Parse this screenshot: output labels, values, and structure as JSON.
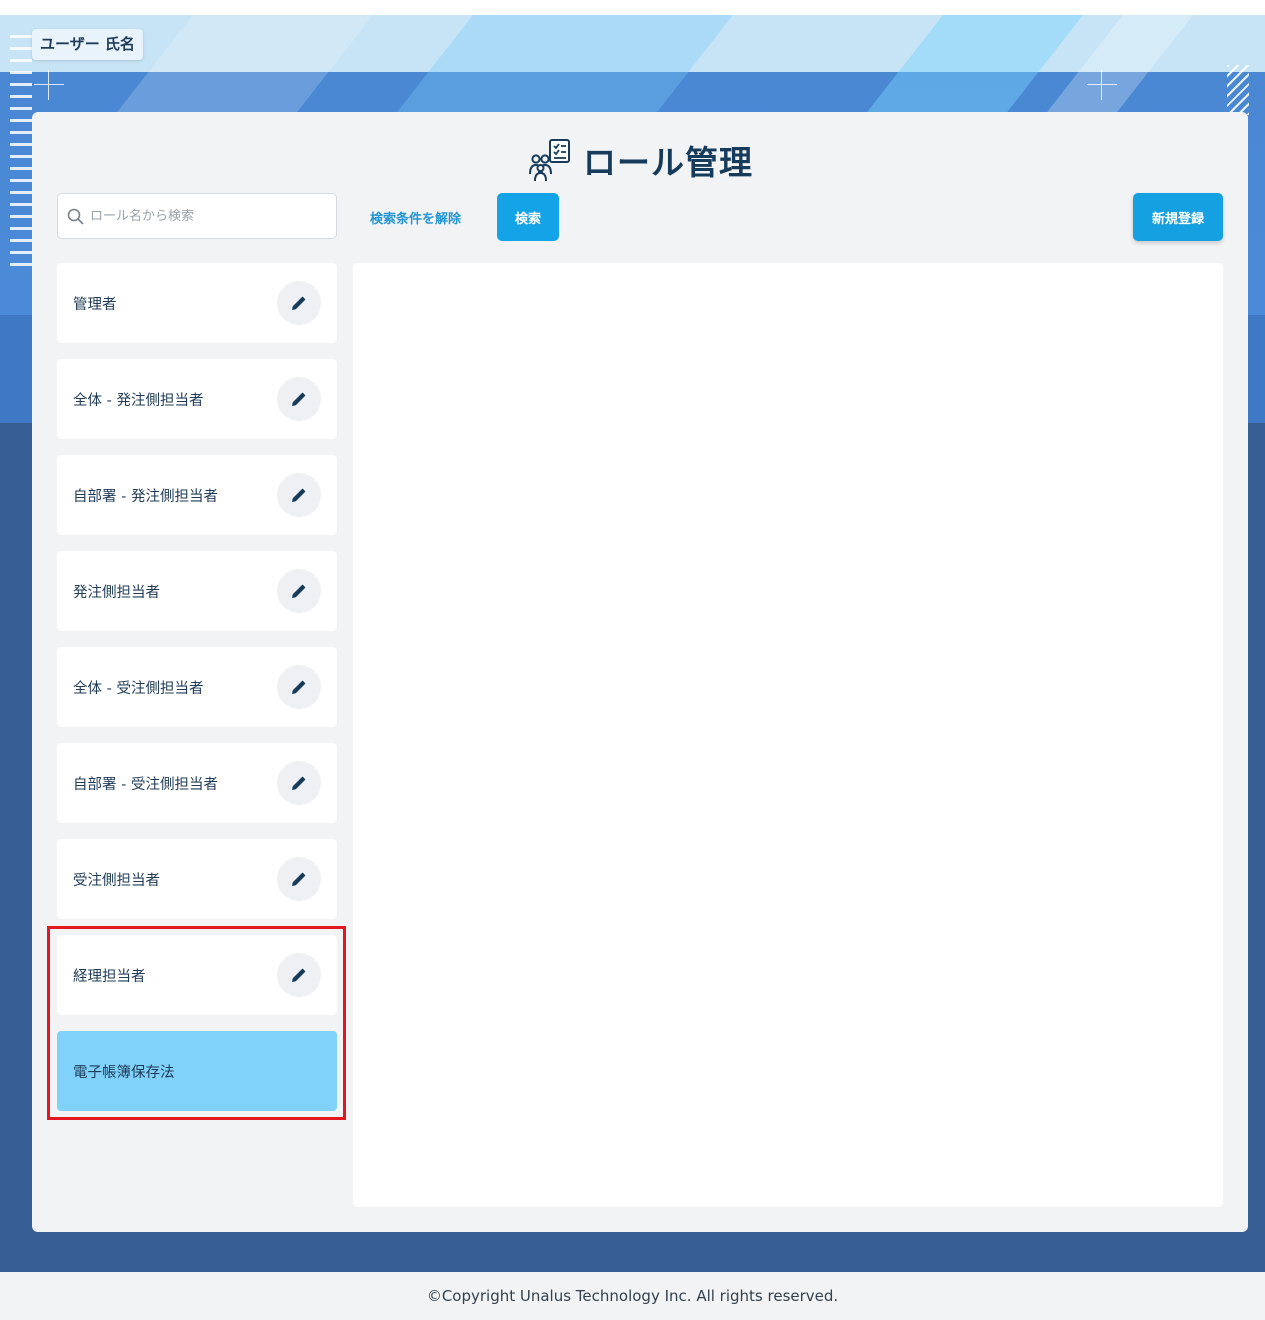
{
  "header": {
    "user_name": "ユーザー 氏名"
  },
  "page": {
    "title": "ロール管理"
  },
  "toolbar": {
    "search_placeholder": "ロール名から検索",
    "search_value": "",
    "clear_label": "検索条件を解除",
    "search_label": "検索",
    "new_label": "新規登録"
  },
  "roles": {
    "items": [
      {
        "label": "管理者",
        "editable": true
      },
      {
        "label": "全体 - 発注側担当者",
        "editable": true
      },
      {
        "label": "自部署 - 発注側担当者",
        "editable": true
      },
      {
        "label": "発注側担当者",
        "editable": true
      },
      {
        "label": "全体 - 受注側担当者",
        "editable": true
      },
      {
        "label": "自部署 - 受注側担当者",
        "editable": true
      },
      {
        "label": "受注側担当者",
        "editable": true
      },
      {
        "label": "経理担当者",
        "editable": true
      },
      {
        "label": "電子帳簿保存法",
        "editable": false,
        "selected": true
      }
    ]
  },
  "footer": {
    "copyright": "©Copyright Unalus Technology Inc. All rights reserved."
  },
  "icons": {
    "title": "role-management-icon",
    "search": "search-icon",
    "edit": "pencil-icon"
  },
  "colors": {
    "accent": "#13a3e6",
    "title": "#173b5a",
    "selected_row": "#80d2fb",
    "highlight_frame": "#e2161e"
  }
}
